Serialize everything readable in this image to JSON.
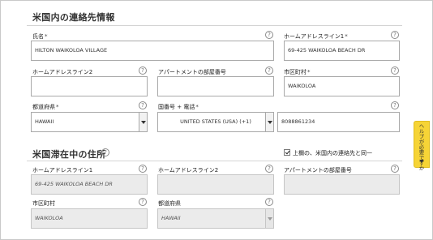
{
  "contact": {
    "title": "米国内の連絡先情報",
    "name_label": "氏名",
    "name_value": "HILTON WAIKOLOA VILLAGE",
    "home_address1_label": "ホームアドレスライン1",
    "home_address1_value": "69-425 WAIKOLOA BEACH DR",
    "home_address2_label": "ホームアドレスライン2",
    "home_address2_value": "",
    "apt_label": "アパートメントの部屋番号",
    "apt_value": "",
    "city_label": "市区町村",
    "city_value": "WAIKOLOA",
    "state_label": "都道府県",
    "state_value": "HAWAII",
    "phone_label": "国番号 + 電話",
    "country_code_value": "UNITED STATES (USA) (+1)",
    "phone_value": "8088861234",
    "required_mark": "*"
  },
  "stay": {
    "title": "米国滞在中の住所",
    "same_as_label": "上欄の、米国内の連絡先と同一",
    "same_as_checked": true,
    "home_address1_label": "ホームアドレスライン1",
    "home_address1_value": "69-425 WAIKOLOA BEACH DR",
    "home_address2_label": "ホームアドレスライン2",
    "home_address2_value": "",
    "apt_label": "アパートメントの部屋番号",
    "apt_value": "",
    "city_label": "市区町村",
    "city_value": "WAIKOLOA",
    "state_label": "都道府県",
    "state_value": "HAWAII"
  },
  "help_glyph": "?",
  "side_tab": {
    "label": "ヘルプが必要ですか"
  },
  "colors": {
    "side_tab": "#f6d436",
    "disabled_field": "#ebebeb"
  }
}
